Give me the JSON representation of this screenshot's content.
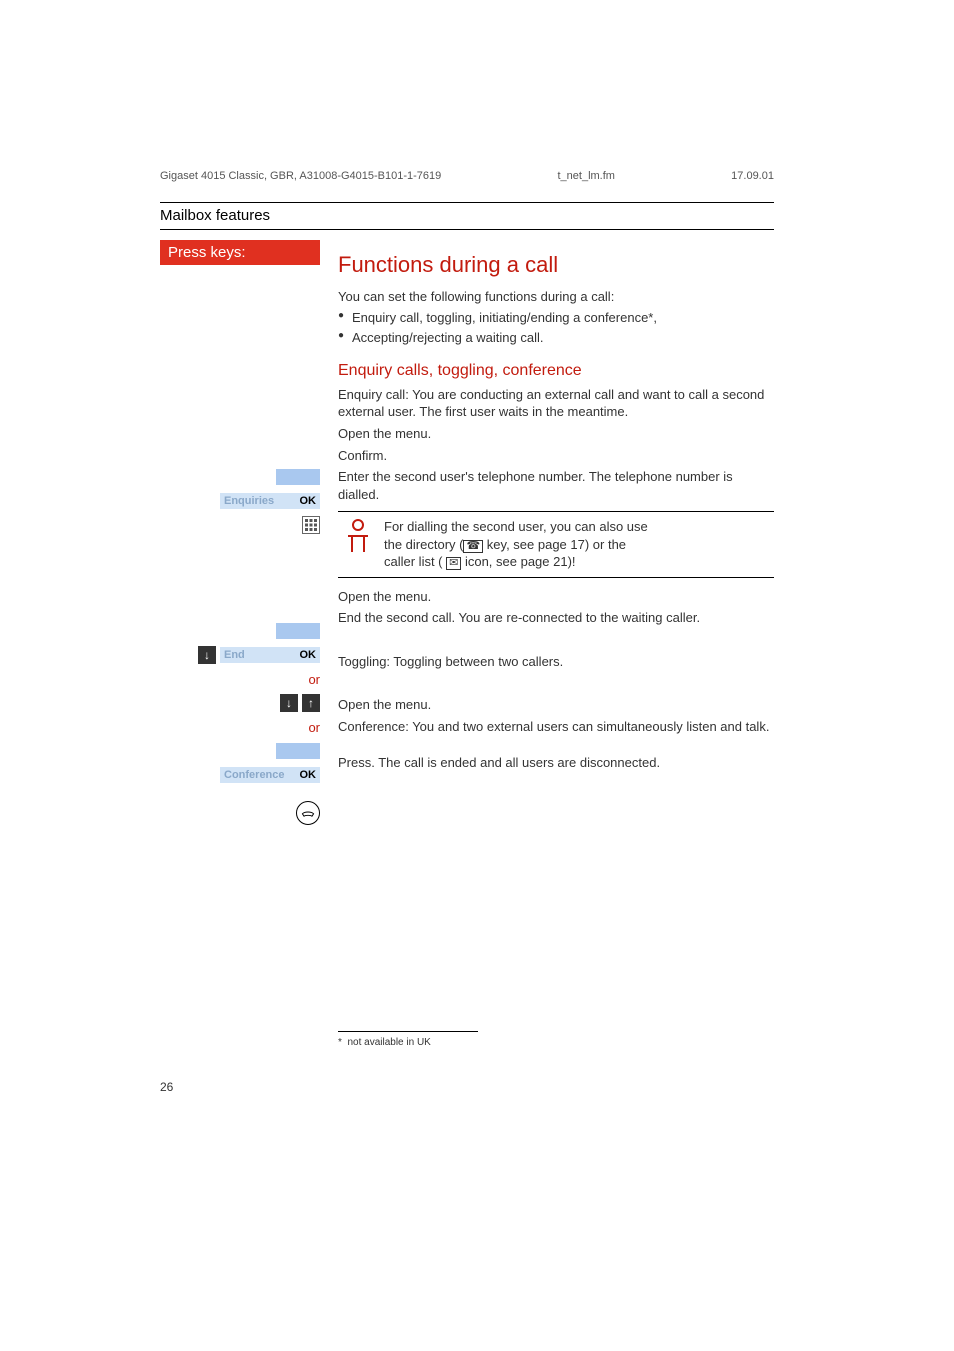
{
  "header": {
    "doc_ref": "Gigaset 4015 Classic, GBR, A31008-G4015-B101-1-7619",
    "file": "t_net_lm.fm",
    "date": "17.09.01"
  },
  "section_title": "Mailbox features",
  "sidebar": {
    "press_keys": "Press keys:",
    "or": "or",
    "ok": "OK",
    "end": "End",
    "enquiries": "Enquiries",
    "conference": "Conference"
  },
  "content": {
    "h1": "Functions during a call",
    "intro": "You can set the following functions during a call:",
    "bullets": [
      "Enquiry call, toggling, initiating/ending a conference*,",
      "Accepting/rejecting a waiting call."
    ],
    "h2": "Enquiry calls, toggling, conference",
    "enquiry_para": "Enquiry call: You are conducting an external call and want to call a second external user. The first user waits in the meantime.",
    "open_menu": "Open the menu.",
    "confirm": "Confirm.",
    "enter_number": "Enter the second user's telephone number. The telephone number is dialled.",
    "tip": {
      "line1": "For dialling the second user, you can also use",
      "line2_a": "the directory (",
      "line2_b": " key, see page 17) or the",
      "line3_a": "caller list ( ",
      "line3_b": " icon, see page 21)!"
    },
    "end_second": "End the second call. You are re-connected to the waiting caller.",
    "toggle": "Toggling: Toggling between two callers.",
    "conf_desc": "Conference: You and two external users can simultaneously listen and talk.",
    "hangup": "Press. The call is ended and all users are disconnected."
  },
  "footnote": {
    "marker": "*",
    "text": "not available in UK"
  },
  "page_number": "26"
}
